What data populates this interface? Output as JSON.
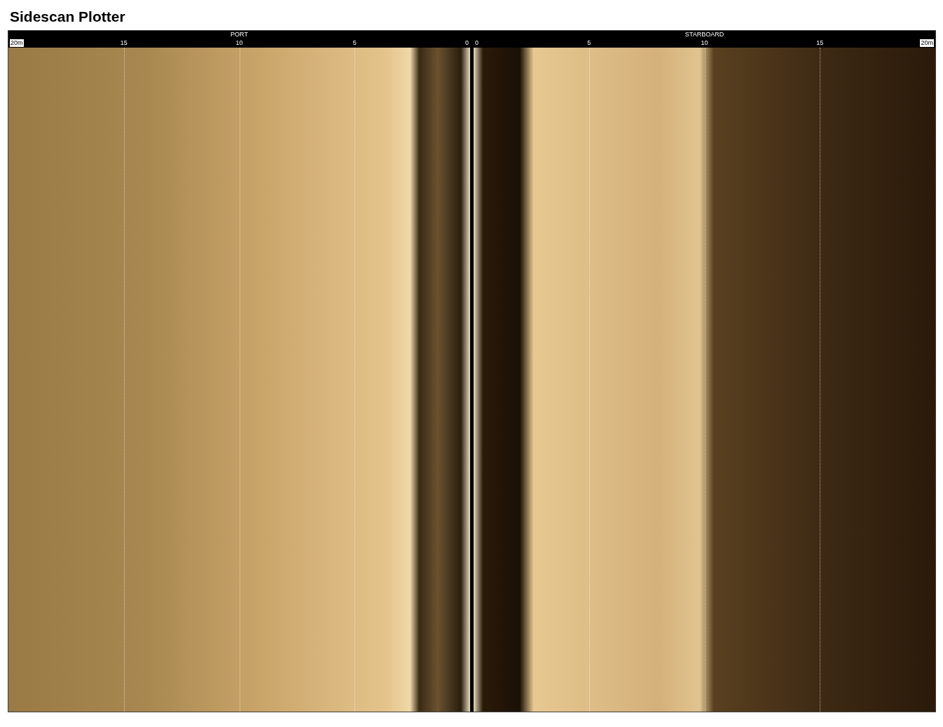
{
  "title": "Sidescan Plotter",
  "sides": [
    {
      "kind": "port",
      "label": "PORT",
      "ticks": [
        {
          "text": "20m",
          "kind": "range"
        },
        {
          "text": "15",
          "kind": "tick"
        },
        {
          "text": "10",
          "kind": "tick"
        },
        {
          "text": "5",
          "kind": "tick"
        },
        {
          "text": "0",
          "kind": "tick"
        }
      ]
    },
    {
      "kind": "starboard",
      "label": "STARBOARD",
      "ticks": [
        {
          "text": "0",
          "kind": "tick"
        },
        {
          "text": "5",
          "kind": "tick"
        },
        {
          "text": "10",
          "kind": "tick"
        },
        {
          "text": "15",
          "kind": "tick"
        },
        {
          "text": "20m",
          "kind": "range"
        }
      ]
    }
  ]
}
